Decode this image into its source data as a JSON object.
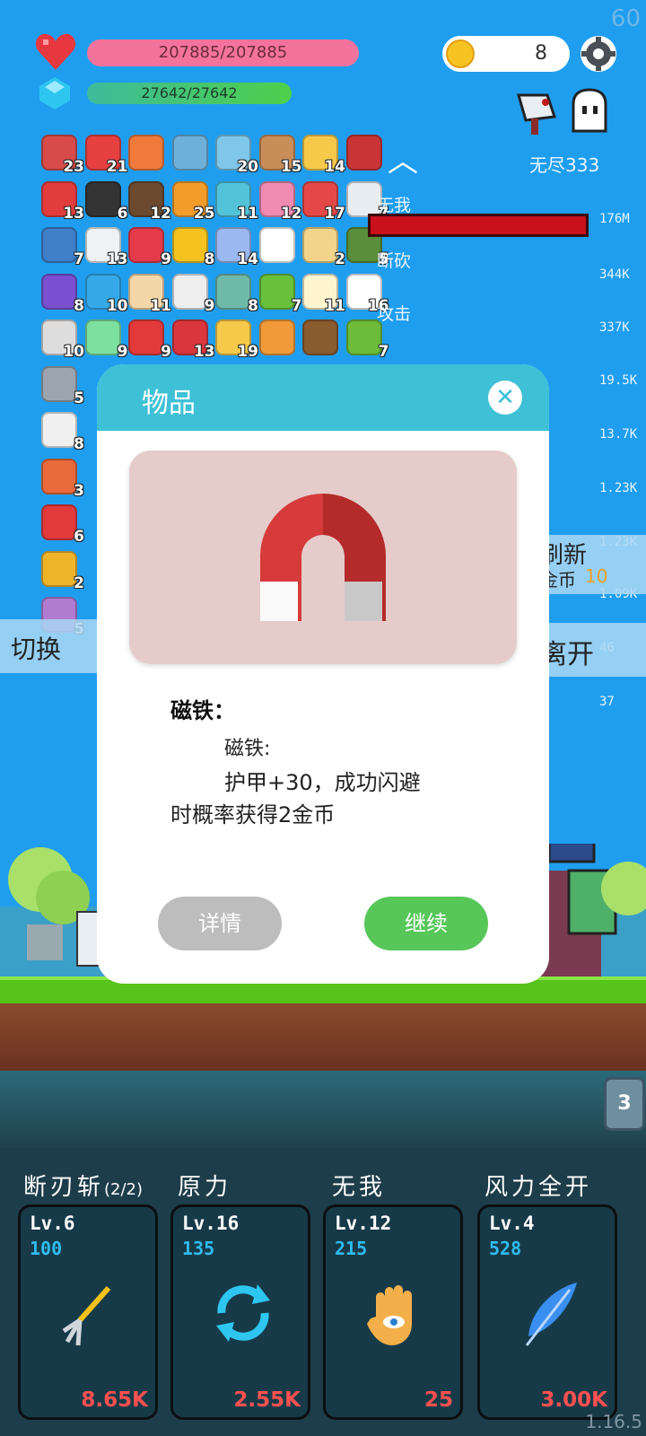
{
  "hud": {
    "fps": "60",
    "hp_text": "207885/207885",
    "mp_text": "27642/27642",
    "coins": "8",
    "endless_label": "无尽333",
    "version": "1.16.5"
  },
  "items": [
    {
      "icon": "jam-jar-icon",
      "count": "23",
      "color": "#d84b4b"
    },
    {
      "icon": "sock-icon",
      "count": "21",
      "color": "#e64040"
    },
    {
      "icon": "crown-icon",
      "count": "",
      "color": "#f07a3c"
    },
    {
      "icon": "magnifier-icon",
      "count": "",
      "color": "#6fb0d8"
    },
    {
      "icon": "star-card-icon",
      "count": "20",
      "color": "#7fc7e8"
    },
    {
      "icon": "donut-icon",
      "count": "15",
      "color": "#c98d5a"
    },
    {
      "icon": "sun-cloud-icon",
      "count": "14",
      "color": "#f6c94a"
    },
    {
      "icon": "magnet-icon",
      "count": "",
      "color": "#c93535"
    },
    {
      "icon": "apple-icon",
      "count": "13",
      "color": "#e33c3c"
    },
    {
      "icon": "cauldron-icon",
      "count": "6",
      "color": "#333333"
    },
    {
      "icon": "coconut-icon",
      "count": "12",
      "color": "#6b4a30"
    },
    {
      "icon": "book-icon",
      "count": "25",
      "color": "#f29c2b"
    },
    {
      "icon": "scroll-icon",
      "count": "11",
      "color": "#52c3d9"
    },
    {
      "icon": "ice-cream-icon",
      "count": "12",
      "color": "#f08ab0"
    },
    {
      "icon": "watermelon-icon",
      "count": "17",
      "color": "#e54848"
    },
    {
      "icon": "cloud-icon",
      "count": "7",
      "color": "#e8edf1"
    },
    {
      "icon": "shield-icon",
      "count": "7",
      "color": "#3f7fc9"
    },
    {
      "icon": "envelope-icon",
      "count": "13",
      "color": "#eef2f5"
    },
    {
      "icon": "heart-icon",
      "count": "9",
      "color": "#e53a4a"
    },
    {
      "icon": "sunflower-icon",
      "count": "8",
      "color": "#f4c320"
    },
    {
      "icon": "pill-icon",
      "count": "14",
      "color": "#9bb8f0"
    },
    {
      "icon": "speech-bubble-icon",
      "count": "",
      "color": "#ffffff"
    },
    {
      "icon": "map-icon",
      "count": "2",
      "color": "#f2d48a"
    },
    {
      "icon": "grenade-icon",
      "count": "5",
      "color": "#5a8e3a"
    },
    {
      "icon": "purple-box-icon",
      "count": "8",
      "color": "#7a4fd0"
    },
    {
      "icon": "chat-icon",
      "count": "10",
      "color": "#35a9e8"
    },
    {
      "icon": "hand-icon",
      "count": "11",
      "color": "#f4d7a8"
    },
    {
      "icon": "dice-icon",
      "count": "9",
      "color": "#eeeeee"
    },
    {
      "icon": "disc-icon",
      "count": "8",
      "color": "#6fb9a8"
    },
    {
      "icon": "lime-icon",
      "count": "7",
      "color": "#69c03a"
    },
    {
      "icon": "fried-egg-icon",
      "count": "11",
      "color": "#fff6d0"
    },
    {
      "icon": "flower-icon",
      "count": "16",
      "color": "#ffffff"
    },
    {
      "icon": "cards-icon",
      "count": "10",
      "color": "#dddddd"
    },
    {
      "icon": "ghost-green-icon",
      "count": "9",
      "color": "#7ee0a0"
    },
    {
      "icon": "mushroom-icon",
      "count": "9",
      "color": "#e23a3a"
    },
    {
      "icon": "strawberry-icon",
      "count": "13",
      "color": "#d9363e"
    },
    {
      "icon": "gold-crown-icon",
      "count": "19",
      "color": "#f6c94a"
    },
    {
      "icon": "briefcase-icon",
      "count": "",
      "color": "#f09a3a"
    },
    {
      "icon": "chest-icon",
      "count": "",
      "color": "#8a5a30"
    },
    {
      "icon": "slime-icon",
      "count": "7",
      "color": "#6dbb3a"
    },
    {
      "icon": "axe-icon",
      "count": "5",
      "color": "#9aa5b0"
    },
    {
      "icon": "bulb-icon",
      "count": "8",
      "color": "#f0f0f0"
    },
    {
      "icon": "flag-icon",
      "count": "3",
      "color": "#e96a3a"
    },
    {
      "icon": "gift-icon",
      "count": "6",
      "color": "#e23a3a"
    },
    {
      "icon": "scroll-yellow-icon",
      "count": "2",
      "color": "#f0b42a"
    },
    {
      "icon": "frame-icon",
      "count": "5",
      "color": "#b07bd0"
    }
  ],
  "damage": [
    {
      "name": "无我",
      "value": "176M"
    },
    {
      "name": "断砍",
      "value": "344K"
    },
    {
      "name": "攻击",
      "value": "337K"
    },
    {
      "name": "",
      "value": "19.5K"
    },
    {
      "name": "",
      "value": "13.7K"
    },
    {
      "name": "",
      "value": "1.23K"
    },
    {
      "name": "",
      "value": "1.23K"
    },
    {
      "name": "",
      "value": "1.09K"
    },
    {
      "name": "",
      "value": "46"
    },
    {
      "name": "",
      "value": "37"
    }
  ],
  "side": {
    "refresh_label": "刷新",
    "refresh_cost_label": "金币",
    "refresh_cost": "10",
    "leave_label": "离开",
    "switch_label": "切换"
  },
  "stage_badge": "3",
  "skills": [
    {
      "name": "断刃斩",
      "suffix": "(2/2)",
      "level": "Lv.6",
      "cost": "100",
      "price": "8.65K",
      "icon": "pitchfork-icon"
    },
    {
      "name": "原力",
      "suffix": "",
      "level": "Lv.16",
      "cost": "135",
      "price": "2.55K",
      "icon": "refresh-icon"
    },
    {
      "name": "无我",
      "suffix": "",
      "level": "Lv.12",
      "cost": "215",
      "price": "25",
      "icon": "hand-eye-icon"
    },
    {
      "name": "风力全开",
      "suffix": "",
      "level": "Lv.4",
      "cost": "528",
      "price": "3.00K",
      "icon": "feather-icon"
    }
  ],
  "dialog": {
    "title": "物品",
    "close": "✕",
    "item_name_header": "磁铁：",
    "line1": "磁铁:",
    "line2": "护甲+30，成功闪避",
    "line3": "时概率获得2金币",
    "detail_button": "详情",
    "continue_button": "继续",
    "panel_color": "#e5cccb"
  }
}
